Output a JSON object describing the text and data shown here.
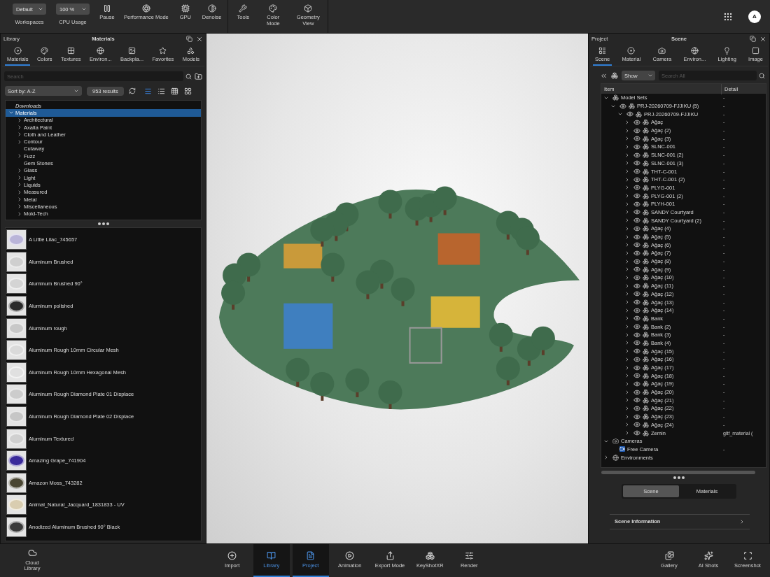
{
  "toolbar": {
    "dropdowns": [
      {
        "value": "Default",
        "label": "Workspaces"
      },
      {
        "value": "100 %",
        "label": "CPU Usage"
      }
    ],
    "groups": [
      [
        {
          "kind": "pause",
          "label": "Pause"
        },
        {
          "kind": "performance",
          "label": "Performance Mode"
        },
        {
          "kind": "gpu",
          "label": "GPU"
        },
        {
          "kind": "denoise",
          "label": "Denoise"
        }
      ],
      [
        {
          "kind": "tools",
          "label": "Tools"
        },
        {
          "kind": "color",
          "label": "Color Mode"
        },
        {
          "kind": "geometry",
          "label": "Geometry View"
        }
      ]
    ],
    "avatar": "A"
  },
  "library": {
    "title": "Library",
    "subtitle": "Materials",
    "tabs": [
      {
        "kind": "materials",
        "label": "Materials",
        "selected": true
      },
      {
        "kind": "colors",
        "label": "Colors",
        "selected": false
      },
      {
        "kind": "textures",
        "label": "Textures",
        "selected": false
      },
      {
        "kind": "environments",
        "label": "Environ...",
        "selected": false
      },
      {
        "kind": "backplates",
        "label": "Backpla...",
        "selected": false
      },
      {
        "kind": "favorites",
        "label": "Favorites",
        "selected": false
      },
      {
        "kind": "models",
        "label": "Models",
        "selected": false
      }
    ],
    "search": {
      "placeholder": "Search"
    },
    "sort": "Sort by: A-Z",
    "results": "953 results",
    "view_modes": [
      {
        "kind": "detail",
        "selected": true
      },
      {
        "kind": "list",
        "selected": false
      },
      {
        "kind": "small-grid",
        "selected": false
      },
      {
        "kind": "grid",
        "selected": false
      }
    ],
    "tree": [
      {
        "label": "Downloads",
        "kind": "shortcut",
        "selected": false
      },
      {
        "label": "Materials",
        "expanded": true,
        "selected": true,
        "children": [
          {
            "label": "Architectural",
            "expanded": false,
            "selected": false
          },
          {
            "label": "Axalta Paint",
            "expanded": false,
            "selected": false
          },
          {
            "label": "Cloth and Leather",
            "expanded": false,
            "selected": false
          },
          {
            "label": "Contour",
            "expanded": false,
            "selected": false
          },
          {
            "label": "Cutaway",
            "selected": false
          },
          {
            "label": "Fuzz",
            "expanded": false,
            "selected": false
          },
          {
            "label": "Gem Stones",
            "selected": false
          },
          {
            "label": "Glass",
            "expanded": false,
            "selected": false
          },
          {
            "label": "Light",
            "expanded": false,
            "selected": false
          },
          {
            "label": "Liquids",
            "expanded": false,
            "selected": false
          },
          {
            "label": "Measured",
            "expanded": false,
            "selected": false
          },
          {
            "label": "Metal",
            "expanded": false,
            "selected": false
          },
          {
            "label": "Miscellaneous",
            "expanded": false,
            "selected": false
          },
          {
            "label": "Mold-Tech",
            "expanded": false,
            "selected": false
          }
        ]
      }
    ],
    "materials": [
      {
        "name": "A Little Lilac_745657",
        "color": "#b9b4d8"
      },
      {
        "name": "Aluminum Brushed",
        "color": "#cfcfcf"
      },
      {
        "name": "Aluminum Brushed 90°",
        "color": "#d4d4d4"
      },
      {
        "name": "Aluminum polished",
        "color": "#2a2a2a"
      },
      {
        "name": "Aluminum rough",
        "color": "#c8c8c8"
      },
      {
        "name": "Aluminum Rough 10mm Circular Mesh",
        "color": "#dadada"
      },
      {
        "name": "Aluminum Rough 10mm Hexagonal Mesh",
        "color": "#e0e0e0"
      },
      {
        "name": "Aluminum Rough Diamond Plate 01 Displace",
        "color": "#cccccc"
      },
      {
        "name": "Aluminum Rough Diamond Plate 02 Displace",
        "color": "#c6c6c6"
      },
      {
        "name": "Aluminum Textured",
        "color": "#d0d0d0"
      },
      {
        "name": "Amazing Grape_741904",
        "color": "#3a2a9a"
      },
      {
        "name": "Amazon Moss_743282",
        "color": "#4a4632"
      },
      {
        "name": "Animal_Natural_Jacquard_1831833 - UV",
        "color": "#d9cdb0"
      },
      {
        "name": "Anodized Aluminum Brushed 90° Black",
        "color": "#3a3a3a"
      }
    ]
  },
  "project": {
    "title": "Project",
    "subtitle": "Scene",
    "tabs": [
      {
        "kind": "scene",
        "label": "Scene",
        "selected": true
      },
      {
        "kind": "material",
        "label": "Material",
        "selected": false
      },
      {
        "kind": "camera",
        "label": "Camera",
        "selected": false
      },
      {
        "kind": "environment",
        "label": "Environ...",
        "selected": false
      },
      {
        "kind": "lighting",
        "label": "Lighting",
        "selected": false
      },
      {
        "kind": "image",
        "label": "Image",
        "selected": false
      }
    ],
    "filter": "Show",
    "search": {
      "placeholder": "Search All"
    },
    "columns": [
      "Item",
      "Detail"
    ],
    "tree": [
      {
        "label": "Model Sets",
        "detail": "-",
        "kind": "model",
        "expanded": true,
        "children": [
          {
            "label": "PRJ-20260709-FJJIKU (5)",
            "detail": "-",
            "kind": "model",
            "visible": true,
            "expanded": true,
            "children": [
              {
                "label": "PRJ-20260709-FJJIKU",
                "detail": "-",
                "kind": "model",
                "visible": true,
                "expanded": true,
                "children": [
                  {
                    "label": "Ağaç",
                    "detail": "-",
                    "kind": "model",
                    "visible": true,
                    "expanded": false
                  },
                  {
                    "label": "Ağaç (2)",
                    "detail": "-",
                    "kind": "model",
                    "visible": true,
                    "expanded": false
                  },
                  {
                    "label": "Ağaç (3)",
                    "detail": "-",
                    "kind": "model",
                    "visible": true,
                    "expanded": false
                  },
                  {
                    "label": "SLNC-001",
                    "detail": "-",
                    "kind": "model",
                    "visible": true,
                    "expanded": false
                  },
                  {
                    "label": "SLNC-001 (2)",
                    "detail": "-",
                    "kind": "model",
                    "visible": true,
                    "expanded": false
                  },
                  {
                    "label": "SLNC-001 (3)",
                    "detail": "-",
                    "kind": "model",
                    "visible": true,
                    "expanded": false
                  },
                  {
                    "label": "THT-C-001",
                    "detail": "-",
                    "kind": "model",
                    "visible": true,
                    "expanded": false
                  },
                  {
                    "label": "THT-C-001 (2)",
                    "detail": "-",
                    "kind": "model",
                    "visible": true,
                    "expanded": false
                  },
                  {
                    "label": "PLYG-001",
                    "detail": "-",
                    "kind": "model",
                    "visible": true,
                    "expanded": false
                  },
                  {
                    "label": "PLYG-001 (2)",
                    "detail": "-",
                    "kind": "model",
                    "visible": true,
                    "expanded": false
                  },
                  {
                    "label": "PLYH-001",
                    "detail": "-",
                    "kind": "model",
                    "visible": true,
                    "expanded": false
                  },
                  {
                    "label": "SANDY Courtyard",
                    "detail": "-",
                    "kind": "model",
                    "visible": true,
                    "expanded": false
                  },
                  {
                    "label": "SANDY Courtyard (2)",
                    "detail": "-",
                    "kind": "model",
                    "visible": true,
                    "expanded": false
                  },
                  {
                    "label": "Ağaç (4)",
                    "detail": "-",
                    "kind": "model",
                    "visible": true,
                    "expanded": false
                  },
                  {
                    "label": "Ağaç (5)",
                    "detail": "-",
                    "kind": "model",
                    "visible": true,
                    "expanded": false
                  },
                  {
                    "label": "Ağaç (6)",
                    "detail": "-",
                    "kind": "model",
                    "visible": true,
                    "expanded": false
                  },
                  {
                    "label": "Ağaç (7)",
                    "detail": "-",
                    "kind": "model",
                    "visible": true,
                    "expanded": false
                  },
                  {
                    "label": "Ağaç (8)",
                    "detail": "-",
                    "kind": "model",
                    "visible": true,
                    "expanded": false
                  },
                  {
                    "label": "Ağaç (9)",
                    "detail": "-",
                    "kind": "model",
                    "visible": true,
                    "expanded": false
                  },
                  {
                    "label": "Ağaç (10)",
                    "detail": "-",
                    "kind": "model",
                    "visible": true,
                    "expanded": false
                  },
                  {
                    "label": "Ağaç (11)",
                    "detail": "-",
                    "kind": "model",
                    "visible": true,
                    "expanded": false
                  },
                  {
                    "label": "Ağaç (12)",
                    "detail": "-",
                    "kind": "model",
                    "visible": true,
                    "expanded": false
                  },
                  {
                    "label": "Ağaç (13)",
                    "detail": "-",
                    "kind": "model",
                    "visible": true,
                    "expanded": false
                  },
                  {
                    "label": "Ağaç (14)",
                    "detail": "-",
                    "kind": "model",
                    "visible": true,
                    "expanded": false
                  },
                  {
                    "label": "Bank",
                    "detail": "-",
                    "kind": "model",
                    "visible": true,
                    "expanded": false
                  },
                  {
                    "label": "Bank (2)",
                    "detail": "-",
                    "kind": "model",
                    "visible": true,
                    "expanded": false
                  },
                  {
                    "label": "Bank (3)",
                    "detail": "-",
                    "kind": "model",
                    "visible": true,
                    "expanded": false
                  },
                  {
                    "label": "Bank (4)",
                    "detail": "-",
                    "kind": "model",
                    "visible": true,
                    "expanded": false
                  },
                  {
                    "label": "Ağaç (15)",
                    "detail": "-",
                    "kind": "model",
                    "visible": true,
                    "expanded": false
                  },
                  {
                    "label": "Ağaç (16)",
                    "detail": "-",
                    "kind": "model",
                    "visible": true,
                    "expanded": false
                  },
                  {
                    "label": "Ağaç (17)",
                    "detail": "-",
                    "kind": "model",
                    "visible": true,
                    "expanded": false
                  },
                  {
                    "label": "Ağaç (18)",
                    "detail": "-",
                    "kind": "model",
                    "visible": true,
                    "expanded": false
                  },
                  {
                    "label": "Ağaç (19)",
                    "detail": "-",
                    "kind": "model",
                    "visible": true,
                    "expanded": false
                  },
                  {
                    "label": "Ağaç (20)",
                    "detail": "-",
                    "kind": "model",
                    "visible": true,
                    "expanded": false
                  },
                  {
                    "label": "Ağaç (21)",
                    "detail": "-",
                    "kind": "model",
                    "visible": true,
                    "expanded": false
                  },
                  {
                    "label": "Ağaç (22)",
                    "detail": "-",
                    "kind": "model",
                    "visible": true,
                    "expanded": false
                  },
                  {
                    "label": "Ağaç (23)",
                    "detail": "-",
                    "kind": "model",
                    "visible": true,
                    "expanded": false
                  },
                  {
                    "label": "Ağaç (24)",
                    "detail": "-",
                    "kind": "model",
                    "visible": true,
                    "expanded": false
                  },
                  {
                    "label": "Zemin",
                    "detail": "gltf_material (",
                    "kind": "model",
                    "visible": true,
                    "expanded": false
                  }
                ]
              }
            ]
          }
        ]
      },
      {
        "label": "Cameras",
        "kind": "camera-group",
        "expanded": true,
        "children": [
          {
            "label": "Free Camera",
            "detail": "-",
            "kind": "camera"
          }
        ]
      },
      {
        "label": "Environments",
        "kind": "environment",
        "expanded": false
      }
    ],
    "switch": [
      {
        "label": "Scene",
        "selected": true
      },
      {
        "label": "Materials",
        "selected": false
      }
    ],
    "info": "Scene Information"
  },
  "bottom_bar": {
    "left": [
      {
        "kind": "cloud",
        "label": "Cloud Library",
        "selected": false
      }
    ],
    "center": [
      {
        "kind": "import",
        "label": "Import",
        "selected": false
      },
      {
        "kind": "library",
        "label": "Library",
        "selected": true
      },
      {
        "kind": "project",
        "label": "Project",
        "selected": true
      },
      {
        "kind": "animation",
        "label": "Animation",
        "selected": false
      },
      {
        "kind": "export",
        "label": "Export Mode",
        "selected": false
      },
      {
        "kind": "xr",
        "label": "KeyShotXR",
        "selected": false
      },
      {
        "kind": "render",
        "label": "Render",
        "selected": false
      }
    ],
    "right": [
      {
        "kind": "gallery",
        "label": "Gallery",
        "selected": false
      },
      {
        "kind": "ai",
        "label": "AI Shots",
        "selected": false
      },
      {
        "kind": "screenshot",
        "label": "Screenshot",
        "selected": false
      }
    ]
  }
}
